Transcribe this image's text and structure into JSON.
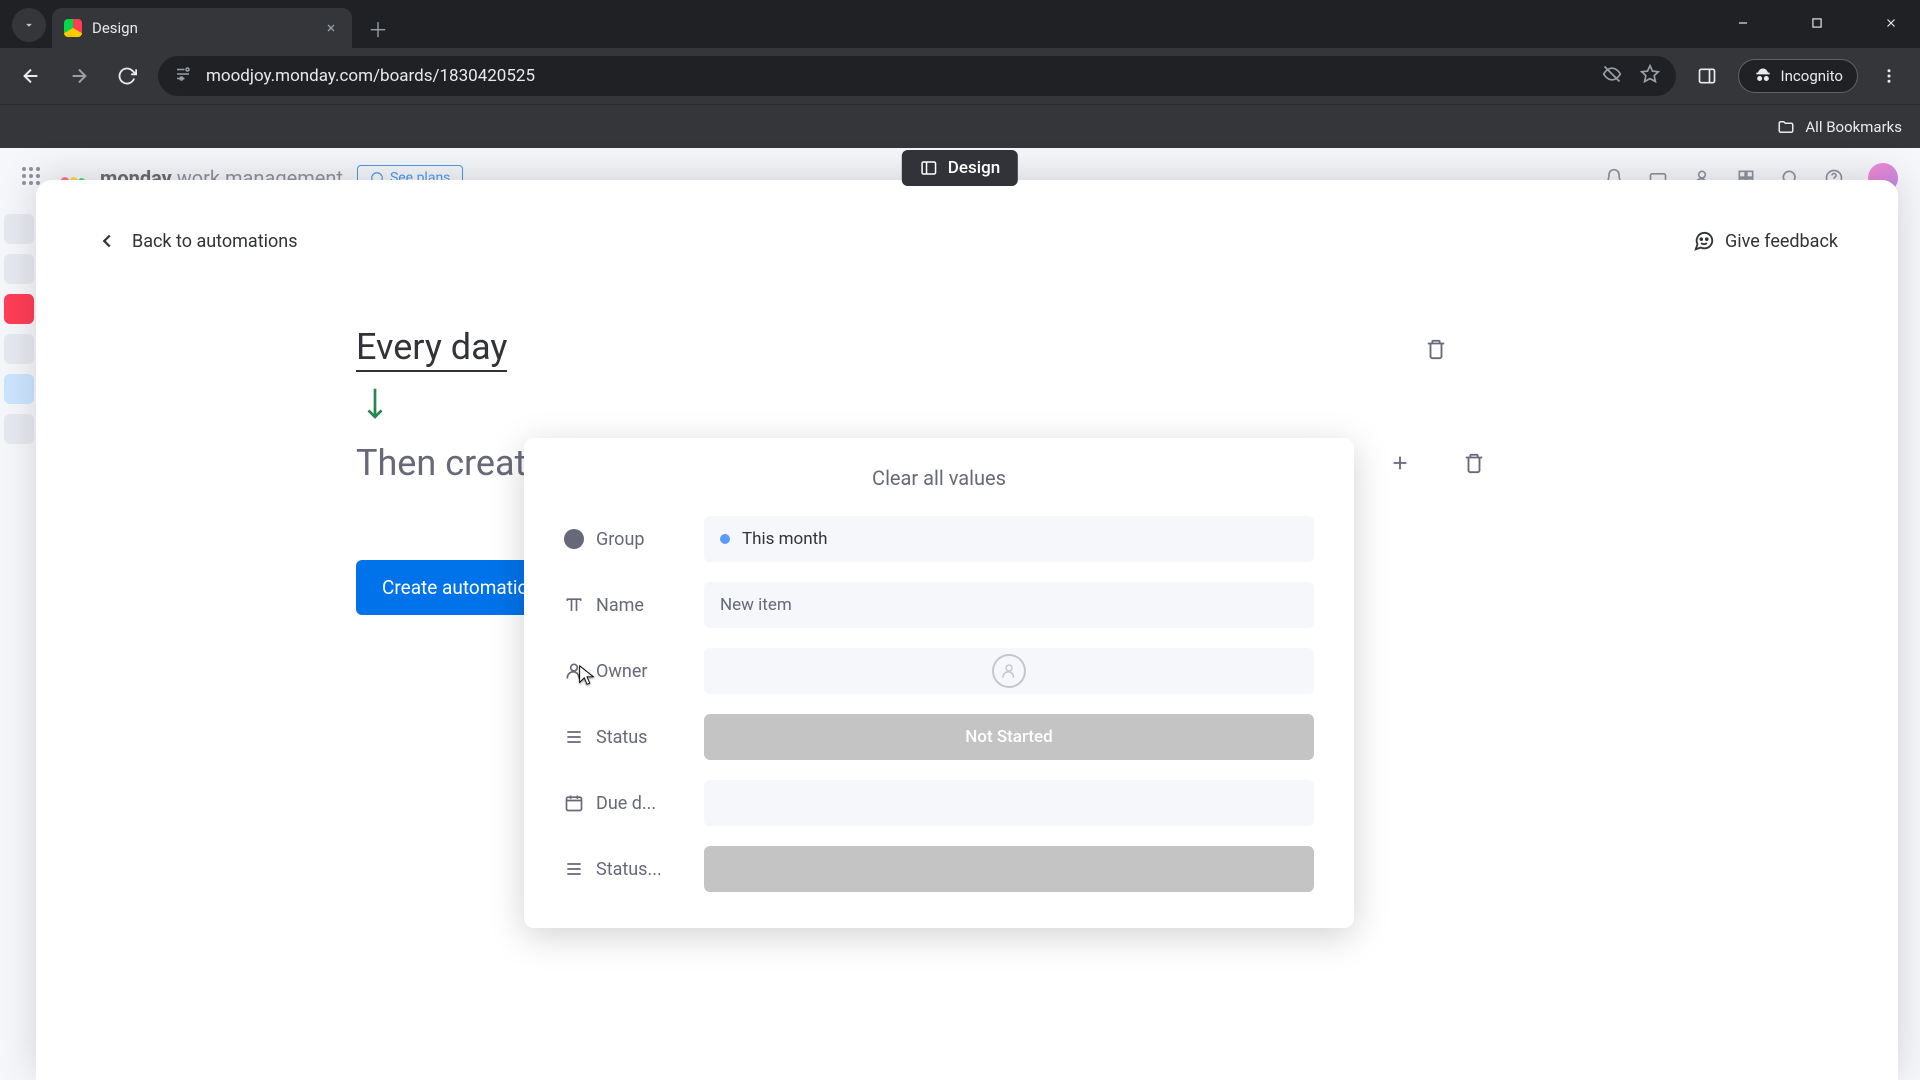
{
  "browser": {
    "tab_title": "Design",
    "url": "moodjoy.monday.com/boards/1830420525",
    "incognito_label": "Incognito",
    "bookmarks_label": "All Bookmarks"
  },
  "monday_header": {
    "brand_main": "monday",
    "brand_sub": "work management",
    "see_plans": "See plans"
  },
  "board_pill": "Design",
  "modal": {
    "back_label": "Back to automations",
    "feedback_label": "Give feedback",
    "trigger_text": "Every day",
    "action_text": "Then create",
    "create_button": "Create automation"
  },
  "popover": {
    "title": "Clear all values",
    "fields": {
      "group": {
        "label": "Group",
        "value": "This month"
      },
      "name": {
        "label": "Name",
        "value": "New item"
      },
      "owner": {
        "label": "Owner"
      },
      "status": {
        "label": "Status",
        "value": "Not Started"
      },
      "due": {
        "label": "Due d..."
      },
      "status2": {
        "label": "Status..."
      }
    }
  }
}
